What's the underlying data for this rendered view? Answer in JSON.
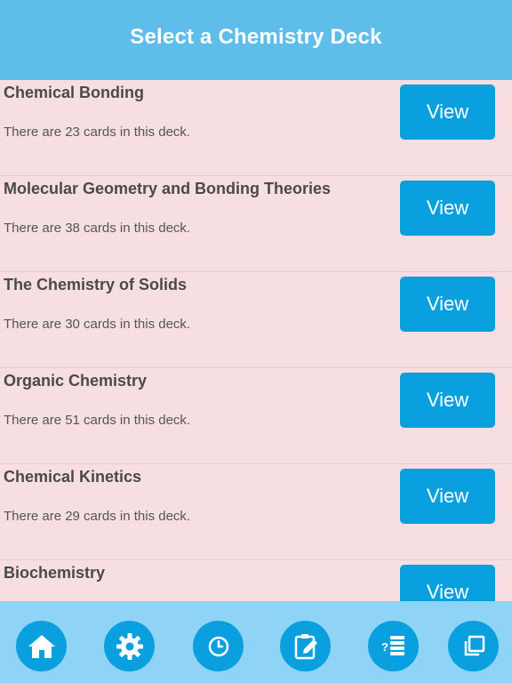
{
  "header": {
    "title": "Select a Chemistry Deck"
  },
  "decks": [
    {
      "title": "Chemical Bonding",
      "count_text": "There are 23 cards in this deck.",
      "button_label": "View"
    },
    {
      "title": "Molecular Geometry and Bonding Theories",
      "count_text": "There are 38 cards in this deck.",
      "button_label": "View"
    },
    {
      "title": "The Chemistry of Solids",
      "count_text": "There are 30 cards in this deck.",
      "button_label": "View"
    },
    {
      "title": "Organic Chemistry",
      "count_text": "There are 51 cards in this deck.",
      "button_label": "View"
    },
    {
      "title": "Chemical Kinetics",
      "count_text": "There are 29 cards in this deck.",
      "button_label": "View"
    },
    {
      "title": "Biochemistry",
      "count_text": "",
      "button_label": "View"
    }
  ],
  "tab_bar": {
    "items": [
      {
        "icon": "home-icon"
      },
      {
        "icon": "gear-icon"
      },
      {
        "icon": "clock-icon"
      },
      {
        "icon": "edit-note-icon"
      },
      {
        "icon": "quiz-list-icon"
      },
      {
        "icon": "copy-cards-icon"
      }
    ]
  },
  "colors": {
    "header": "#5fbde9",
    "background": "#f7dfe1",
    "button": "#0aa0e0",
    "tab_bar": "#8fd3f6"
  }
}
